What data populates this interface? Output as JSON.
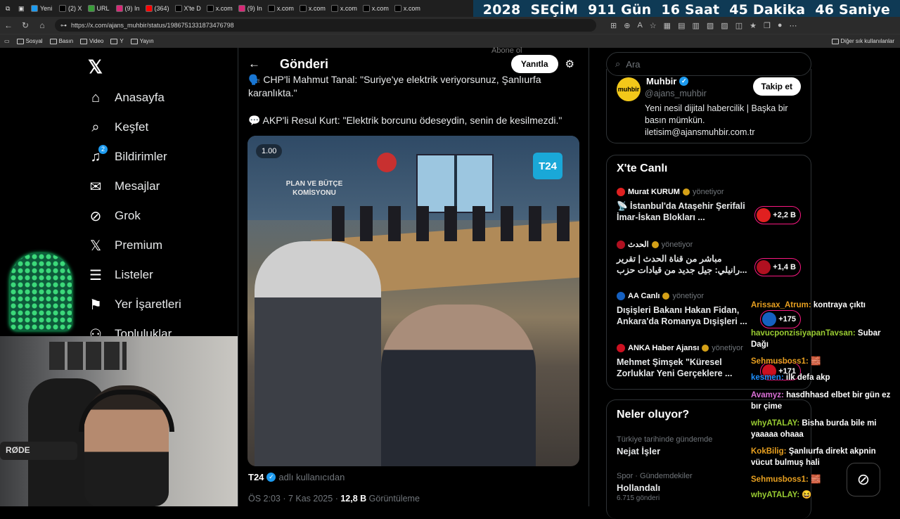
{
  "browser": {
    "tabs": [
      {
        "label": "Yeni",
        "color": "#1d9bf0"
      },
      {
        "label": "(2) X",
        "color": "#000"
      },
      {
        "label": "URL",
        "color": "#3a9e3a"
      },
      {
        "label": "(9) In",
        "color": "#d62976"
      },
      {
        "label": "(364)",
        "color": "#ff0000"
      },
      {
        "label": "X'te D",
        "color": "#000"
      },
      {
        "label": "x.com",
        "color": "#000"
      },
      {
        "label": "(9) In",
        "color": "#d62976"
      },
      {
        "label": "x.com",
        "color": "#000"
      },
      {
        "label": "x.com",
        "color": "#000"
      },
      {
        "label": "x.com",
        "color": "#000"
      },
      {
        "label": "x.com",
        "color": "#000"
      },
      {
        "label": "x.com",
        "color": "#000"
      }
    ],
    "url": "https://x.com/ajans_muhbir/status/1986751331873476798",
    "bookmarks": [
      "Sosyal",
      "Basın",
      "Video",
      "Y",
      "Yayın"
    ],
    "other_bookmarks": "Diğer sık kullanılanlar"
  },
  "countdown": {
    "year": "2028",
    "label": "SEÇİM",
    "days": "911 Gün",
    "hours": "16 Saat",
    "minutes": "45 Dakika",
    "seconds": "46 Saniye"
  },
  "sidebar": {
    "items": [
      {
        "label": "Anasayfa",
        "icon": "home-icon"
      },
      {
        "label": "Keşfet",
        "icon": "search-icon"
      },
      {
        "label": "Bildirimler",
        "icon": "bell-icon",
        "badge": "2"
      },
      {
        "label": "Mesajlar",
        "icon": "mail-icon"
      },
      {
        "label": "Grok",
        "icon": "grok-icon"
      },
      {
        "label": "Premium",
        "icon": "x-logo-icon"
      },
      {
        "label": "Listeler",
        "icon": "list-icon"
      },
      {
        "label": "Yer İşaretleri",
        "icon": "bookmark-icon"
      },
      {
        "label": "Topluluklar",
        "icon": "community-icon"
      }
    ]
  },
  "post": {
    "header_title": "Gönderi",
    "reply_button": "Yanıtla",
    "top_label": "Abone ol",
    "line1": "🗣️ CHP'li Mahmut Tanal: \"Suriye'ye elektrik veriyorsunuz, Şanlıurfa karanlıkta.\"",
    "line2": "💬 AKP'li Resul Kurt: \"Elektrik borcunu ödeseydin, senin de kesilmezdi.\"",
    "video_speed": "1.00",
    "video_badge": "T24",
    "video_sign": "PLAN VE BÜTÇE KOMİSYONU",
    "source_name": "T24",
    "source_suffix": "adlı kullanıcıdan",
    "meta_time": "ÖS 2:03 · 7 Kas 2025 · ",
    "meta_views": "12,8 B",
    "meta_views_label": " Görüntüleme"
  },
  "right": {
    "search_placeholder": "Ara",
    "profile": {
      "logo": "muhbir",
      "name": "Muhbir",
      "handle": "@ajans_muhbir",
      "bio": "Yeni nesil dijital habercilik | Başka bir basın mümkün. iletisim@ajansmuhbir.com.tr",
      "follow": "Takip et"
    },
    "live": {
      "title": "X'te Canlı",
      "items": [
        {
          "host": "Murat KURUM",
          "role": "yönetiyor",
          "text": "📡 İstanbul'da Ataşehir Şerifali İmar-İskan Blokları ...",
          "count": "+2,2 B",
          "color": "#e02020"
        },
        {
          "host": "الحدث",
          "role": "yönetiyor",
          "text": "مباشر من قناة الحدث | تقرير رانيلي: جيل جديد من قيادات حزب...",
          "count": "+1,4 B",
          "color": "#b01020"
        },
        {
          "host": "AA Canlı",
          "role": "yönetiyor",
          "text": "Dışişleri Bakanı Hakan Fidan, Ankara'da Romanya Dışişleri ...",
          "count": "+175",
          "color": "#1560c0"
        },
        {
          "host": "ANKA Haber Ajansı",
          "role": "yönetiyor",
          "text": "Mehmet Şimşek \"Küresel Zorluklar Yeni Gerçeklere ...",
          "count": "+171",
          "color": "#cc1020"
        }
      ]
    },
    "trends": {
      "title": "Neler oluyor?",
      "items": [
        {
          "context": "Türkiye tarihinde gündemde",
          "name": "Nejat İşler",
          "posts": ""
        },
        {
          "context": "Spor · Gündemdekiler",
          "name": "Hollandalı",
          "posts": "6.715 gönderi"
        }
      ]
    }
  },
  "chat": [
    {
      "user": "Arissax_Atrum:",
      "msg": "kontraya çıktı",
      "color": "#e8a020"
    },
    {
      "user": "havucponzisiyapanTavsan:",
      "msg": "Subar Dağı",
      "color": "#9acd32"
    },
    {
      "user": "Sehmusboss1:",
      "msg": "🧱",
      "color": "#e8a020"
    },
    {
      "user": "kesmen:",
      "msg": "ilk defa akp",
      "color": "#1e90ff"
    },
    {
      "user": "Avamyz:",
      "msg": "hasdhhasd elbet bir gün ez bır çime",
      "color": "#da70d6"
    },
    {
      "user": "whyATALAY:",
      "msg": "Bisha burda bile mi yaaaaa ohaaa",
      "color": "#9acd32"
    },
    {
      "user": "KokBilig:",
      "msg": "Şanlıurfa direkt akpnin vücut bulmuş hali",
      "color": "#e8a020"
    },
    {
      "user": "Sehmusboss1:",
      "msg": "🧱",
      "color": "#e8a020"
    },
    {
      "user": "whyATALAY:",
      "msg": "😆",
      "color": "#9acd32"
    }
  ]
}
